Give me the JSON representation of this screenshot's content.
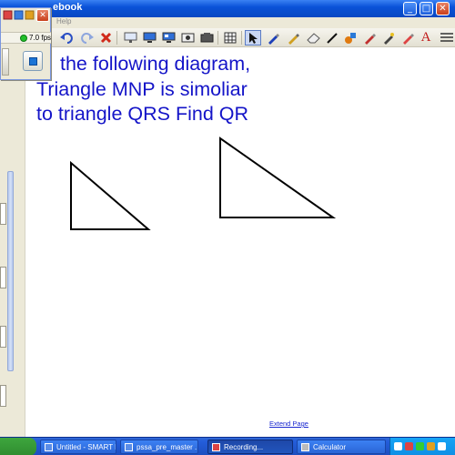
{
  "window": {
    "title": "ebook",
    "menu": {
      "help": "Help"
    },
    "buttons": {
      "minimize": "_",
      "maximize": "□",
      "close": "✕"
    }
  },
  "recorder": {
    "fps": "7.0 fps",
    "close": "✕"
  },
  "toolbar": {
    "items": [
      "undo-icon",
      "redo-icon",
      "delete-icon",
      "screen-shade-icon",
      "display-icon",
      "projector-icon",
      "capture-icon",
      "table-icon",
      "select-arrow-icon",
      "pen-icon",
      "creative-pen-icon",
      "eraser-icon",
      "line-icon",
      "fill-icon",
      "magic-pen-icon",
      "shape-pen-icon",
      "text-icon",
      "more-icon"
    ],
    "text_tool_label": "A"
  },
  "canvas": {
    "problem_lines": [
      "the following diagram,",
      "Triangle MNP is simoliar",
      "to triangle QRS Find QR"
    ],
    "extend_page": "Extend Page"
  },
  "taskbar": {
    "tasks": [
      {
        "label": "Untitled - SMART N...",
        "active": false
      },
      {
        "label": "pssa_pre_master ...",
        "active": false
      },
      {
        "label": "Recording...",
        "active": true
      },
      {
        "label": "Calculator",
        "active": false
      }
    ]
  },
  "colors": {
    "problem_text": "#1414c8",
    "title_bar": "#0a52d8",
    "taskbar": "#245edb",
    "fps_indicator": "#22c02a"
  }
}
